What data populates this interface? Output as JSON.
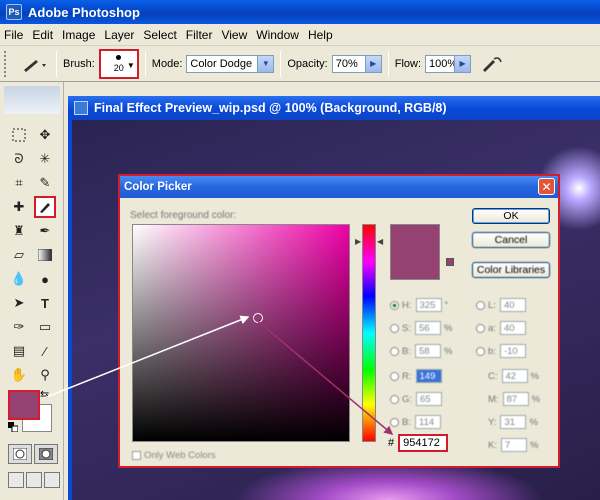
{
  "app": {
    "title": "Adobe Photoshop",
    "logo_text": "Ps"
  },
  "menu": [
    "File",
    "Edit",
    "Image",
    "Layer",
    "Select",
    "Filter",
    "View",
    "Window",
    "Help"
  ],
  "options": {
    "brush_label": "Brush:",
    "brush_size": "20",
    "mode_label": "Mode:",
    "mode_value": "Color Dodge",
    "opacity_label": "Opacity:",
    "opacity_value": "70%",
    "flow_label": "Flow:",
    "flow_value": "100%"
  },
  "toolbox": {
    "foreground_color": "#954172",
    "background_color": "#ffffff"
  },
  "document": {
    "title": "Final Effect Preview_wip.psd @ 100% (Background, RGB/8)"
  },
  "color_picker": {
    "title": "Color Picker",
    "label": "Select foreground color:",
    "ok": "OK",
    "cancel": "Cancel",
    "libraries": "Color Libraries",
    "hsb": [
      {
        "label": "H:",
        "value": "325",
        "unit": "°"
      },
      {
        "label": "S:",
        "value": "56",
        "unit": "%"
      },
      {
        "label": "B:",
        "value": "58",
        "unit": "%"
      }
    ],
    "rgb": [
      {
        "label": "R:",
        "value": "149"
      },
      {
        "label": "G:",
        "value": "65"
      },
      {
        "label": "B:",
        "value": "114"
      }
    ],
    "lab": [
      {
        "label": "L:",
        "value": "40"
      },
      {
        "label": "a:",
        "value": "40"
      },
      {
        "label": "b:",
        "value": "-10"
      }
    ],
    "cmyk": [
      {
        "label": "C:",
        "value": "42",
        "unit": "%"
      },
      {
        "label": "M:",
        "value": "87",
        "unit": "%"
      },
      {
        "label": "Y:",
        "value": "31",
        "unit": "%"
      },
      {
        "label": "K:",
        "value": "7",
        "unit": "%"
      }
    ],
    "hex_label": "#",
    "hex_value": "954172",
    "web_colors_label": "Only Web Colors",
    "selected_color": "#954172"
  }
}
